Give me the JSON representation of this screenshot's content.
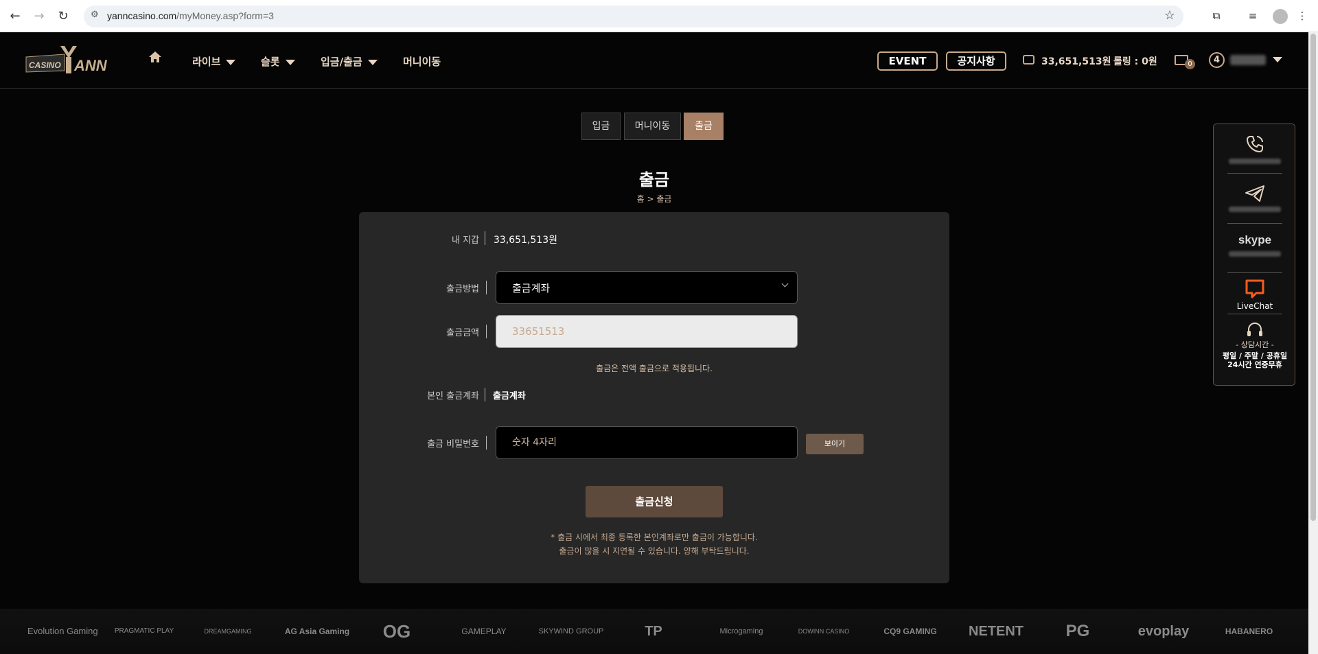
{
  "browser": {
    "url_domain": "yanncasino.com",
    "url_path": "/myMoney.asp?form=3"
  },
  "header": {
    "logo_text": "CASINO YANN",
    "menu": [
      {
        "label": "라이브",
        "has_caret": true
      },
      {
        "label": "슬롯",
        "has_caret": true
      },
      {
        "label": "입금/출금",
        "has_caret": true
      },
      {
        "label": "머니이동",
        "has_caret": false
      }
    ],
    "event_label": "EVENT",
    "notice_label": "공지사항",
    "balance": "33,651,513원",
    "rolling": "롤링 : 0원",
    "mail_count": "0",
    "level": "4"
  },
  "tabs": [
    {
      "label": "입금",
      "active": false
    },
    {
      "label": "머니이동",
      "active": false
    },
    {
      "label": "출금",
      "active": true
    }
  ],
  "page": {
    "title": "출금",
    "breadcrumb": "홈 > 출금"
  },
  "form": {
    "wallet_label": "내 지갑",
    "wallet_value": "33,651,513원",
    "method_label": "출금방법",
    "method_value": "출금계좌",
    "amount_label": "출금금액",
    "amount_value": "33651513",
    "amount_note": "출금은 전액 출금으로 적용됩니다.",
    "account_label": "본인 출금계좌",
    "account_value": "출금계좌",
    "password_label": "출금 비밀번호",
    "password_placeholder": "숫자 4자리",
    "show_button": "보이기",
    "submit_button": "출금신청",
    "footnote_1": "* 출금 시에서 최종 등록한 본인계좌로만 출금이 가능합니다.",
    "footnote_2": "출금이 많을 시 지연될 수 있습니다. 양해 부탁드립니다."
  },
  "side_widget": {
    "livechat_label": "LiveChat",
    "skype_label": "skype",
    "hours_title": "- 상담시간 -",
    "hours_line1": "평일 / 주말 / 공휴일",
    "hours_line2": "24시간 연중무휴"
  },
  "providers": [
    "Evolution Gaming",
    "PRAGMATIC PLAY",
    "DREAMGAMING",
    "AG Asia Gaming",
    "OG",
    "GAMEPLAY",
    "SKYWIND GROUP",
    "TP",
    "Microgaming",
    "DOWINN CASINO",
    "CQ9 GAMING",
    "NETENT",
    "PG",
    "evoplay",
    "HABANERO"
  ],
  "colors": {
    "accent": "#a88066",
    "panel_bg": "#272727",
    "gold_text": "#d4bba3"
  }
}
